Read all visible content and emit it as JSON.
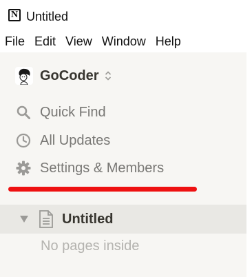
{
  "window": {
    "title": "Untitled"
  },
  "menu": [
    "File",
    "Edit",
    "View",
    "Window",
    "Help"
  ],
  "workspace": {
    "name": "GoCoder"
  },
  "nav": {
    "quick_find": "Quick Find",
    "all_updates": "All Updates",
    "settings": "Settings & Members"
  },
  "pages": [
    {
      "title": "Untitled",
      "empty_note": "No pages inside"
    }
  ],
  "colors": {
    "annotation_underline": "#ee1111",
    "sidebar_bg": "#f7f6f3",
    "selected_row": "#e9e8e4"
  }
}
